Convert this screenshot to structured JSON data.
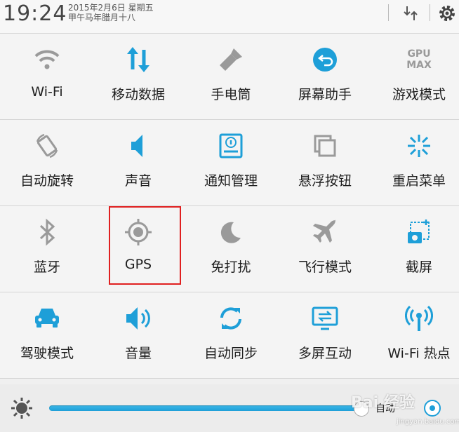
{
  "status_bar": {
    "time": "19:24",
    "date": "2015年2月6日 星期五",
    "lunar": "甲午马年腊月十八"
  },
  "colors": {
    "accent": "#1e9fd8",
    "inactive": "#9a9a9a",
    "highlight": "#e02020"
  },
  "rows": [
    [
      {
        "label": "Wi-Fi",
        "icon": "wifi-icon"
      },
      {
        "label": "移动数据",
        "icon": "mobile-data-icon"
      },
      {
        "label": "手电筒",
        "icon": "flashlight-icon"
      },
      {
        "label": "屏幕助手",
        "icon": "screen-assistant-icon"
      },
      {
        "label": "游戏模式",
        "icon": "gpu-max-icon",
        "icon_text": [
          "GPU",
          "MAX"
        ]
      }
    ],
    [
      {
        "label": "自动旋转",
        "icon": "auto-rotate-icon"
      },
      {
        "label": "声音",
        "icon": "sound-icon"
      },
      {
        "label": "通知管理",
        "icon": "notification-manage-icon"
      },
      {
        "label": "悬浮按钮",
        "icon": "floating-button-icon"
      },
      {
        "label": "重启菜单",
        "icon": "restart-menu-icon"
      }
    ],
    [
      {
        "label": "蓝牙",
        "icon": "bluetooth-icon"
      },
      {
        "label": "GPS",
        "icon": "gps-icon"
      },
      {
        "label": "免打扰",
        "icon": "do-not-disturb-icon"
      },
      {
        "label": "飞行模式",
        "icon": "airplane-mode-icon"
      },
      {
        "label": "截屏",
        "icon": "screenshot-icon"
      }
    ],
    [
      {
        "label": "驾驶模式",
        "icon": "driving-mode-icon"
      },
      {
        "label": "音量",
        "icon": "volume-icon"
      },
      {
        "label": "自动同步",
        "icon": "auto-sync-icon"
      },
      {
        "label": "多屏互动",
        "icon": "multi-screen-icon"
      },
      {
        "label": "Wi-Fi 热点",
        "icon": "wifi-hotspot-icon"
      }
    ]
  ],
  "brightness": {
    "auto_label": "自动",
    "level_percent": 96
  },
  "watermark": {
    "brand": "Bai 经验",
    "url": "jingyan.baidu.com"
  }
}
